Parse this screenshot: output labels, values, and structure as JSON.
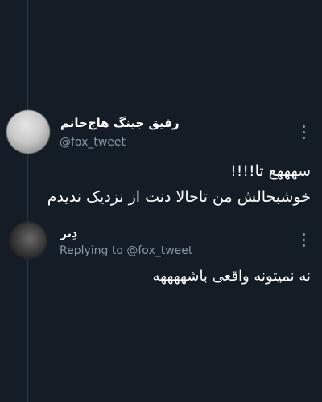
{
  "tweet": {
    "author_name": "رفیق جینگ هاج‌خانم",
    "author_handle": "@fox_tweet",
    "line1": "سهههع تا!!!!",
    "line2": "خوشبحالش من تاحالا دنت از نزدیک ندیدم",
    "avatar_icon": "blurred-avatar",
    "menu_icon": "vertical-dots"
  },
  "reply": {
    "author_name": "دِتر",
    "replying_to": "Replying to @fox_tweet",
    "text": "نه نمیتونه واقعی باشههههه",
    "avatar_icon": "blurred-avatar",
    "menu_icon": "vertical-dots"
  },
  "colors": {
    "background": "#141d26",
    "text": "#ffffff",
    "secondary_text": "#8899a6",
    "thread_line": "#2c3947"
  }
}
